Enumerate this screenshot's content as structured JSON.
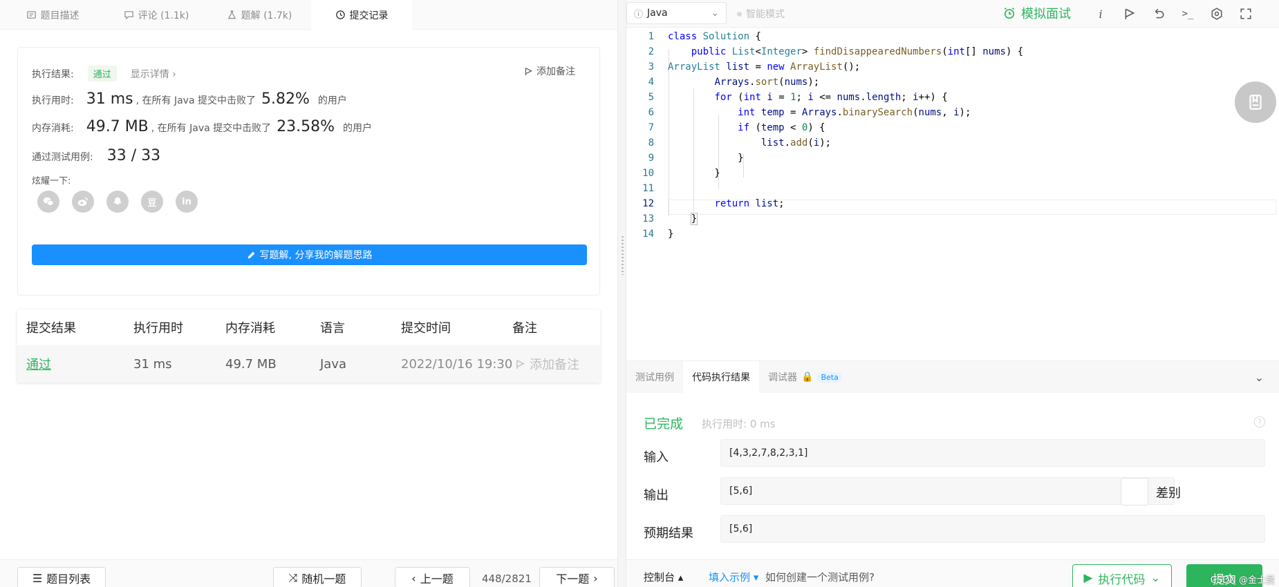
{
  "left_tabs": [
    {
      "label": "题目描述"
    },
    {
      "label": "评论 (1.1k)"
    },
    {
      "label": "题解 (1.7k)"
    },
    {
      "label": "提交记录"
    }
  ],
  "result": {
    "status_label": "执行结果:",
    "status_value": "通过",
    "details_link": "显示详情 ›",
    "add_note": "添加备注",
    "time_label": "执行用时:",
    "time_value": "31 ms",
    "time_desc": ", 在所有 Java 提交中击败了",
    "time_pct": "5.82%",
    "time_suffix": "的用户",
    "mem_label": "内存消耗:",
    "mem_value": "49.7 MB",
    "mem_desc": ", 在所有 Java 提交中击败了",
    "mem_pct": "23.58%",
    "mem_suffix": "的用户",
    "tests_label": "通过测试用例:",
    "tests_value": "33 / 33",
    "share_label": "炫耀一下:",
    "share_douban": "豆",
    "share_linkedin": "in",
    "write_solution": "写题解, 分享我的解题思路"
  },
  "submissions": {
    "headers": [
      "提交结果",
      "执行用时",
      "内存消耗",
      "语言",
      "提交时间",
      "备注"
    ],
    "rows": [
      {
        "result": "通过",
        "time": "31 ms",
        "memory": "49.7 MB",
        "lang": "Java",
        "submitted": "2022/10/16 19:30",
        "note": "添加备注"
      }
    ]
  },
  "left_bottom": {
    "problem_list": "题目列表",
    "random": "随机一题",
    "prev": "上一题",
    "counter": "448/2821",
    "next": "下一题"
  },
  "toolbar": {
    "language": "Java",
    "smart_mode": "智能模式",
    "mock_interview": "模拟面试",
    "info_glyph": "i",
    "terminal_glyph": ">_"
  },
  "editor": {
    "line_numbers": [
      "1",
      "2",
      "3",
      "4",
      "5",
      "6",
      "7",
      "8",
      "9",
      "10",
      "11",
      "12",
      "13",
      "14"
    ]
  },
  "console": {
    "tabs": [
      "测试用例",
      "代码执行结果",
      "调试器"
    ],
    "beta": "Beta",
    "status": "已完成",
    "runtime": "执行用时: 0 ms",
    "help_glyph": "?",
    "input_label": "输入",
    "input_value": "[4,3,2,7,8,2,3,1]",
    "output_label": "输出",
    "output_value": "[5,6]",
    "diff_label": "差别",
    "expected_label": "预期结果",
    "expected_value": "[5,6]"
  },
  "right_bottom": {
    "console": "控制台 ▴",
    "fill_example": "填入示例 ▾",
    "how_to": "如何创建一个测试用例?",
    "run_code": "执行代码",
    "submit": "提交",
    "watermark": "CSDN @金士曼"
  }
}
